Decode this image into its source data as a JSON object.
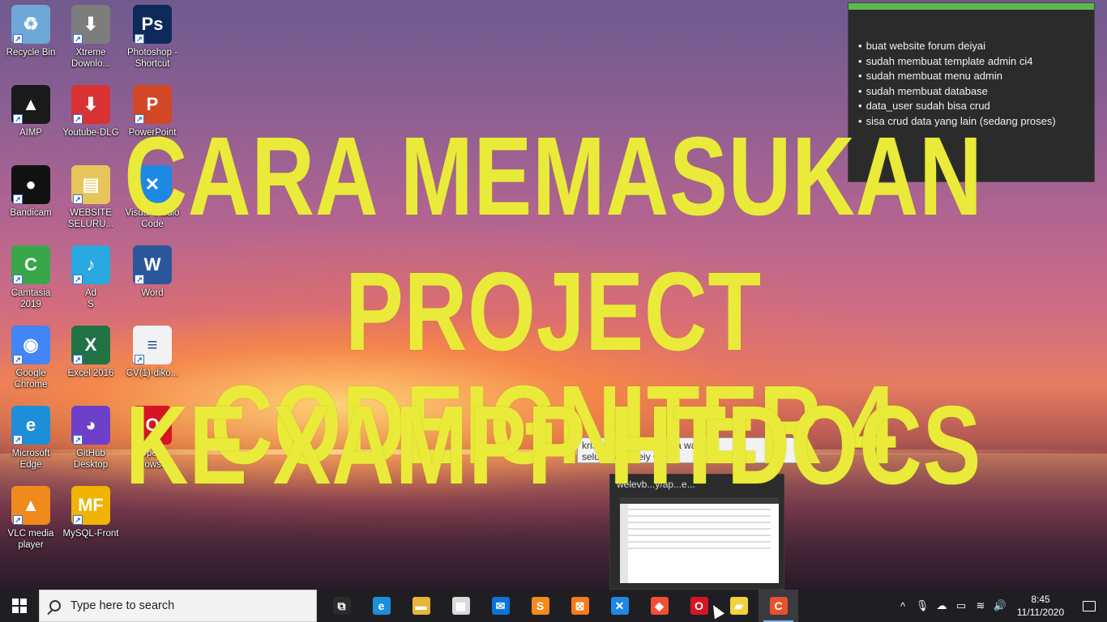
{
  "desktop_icons": [
    {
      "label": "Recycle Bin",
      "icon": "recycle-bin-icon",
      "color": "#6ea8d8",
      "glyph": "♻"
    },
    {
      "label": "Xtreme\nDownlo...",
      "icon": "download-icon",
      "color": "#7d7d7d",
      "glyph": "⬇"
    },
    {
      "label": "Photoshop -\nShortcut",
      "icon": "photoshop-icon",
      "color": "#0d2a5a",
      "glyph": "Ps"
    },
    {
      "label": "AIMP",
      "icon": "aimp-icon",
      "color": "#1a1a1a",
      "glyph": "▲"
    },
    {
      "label": "Youtube-DLG",
      "icon": "youtube-dlg-icon",
      "color": "#d83232",
      "glyph": "⬇"
    },
    {
      "label": "PowerPoint\n2016",
      "icon": "powerpoint-icon",
      "color": "#d24726",
      "glyph": "P"
    },
    {
      "label": "Bandicam",
      "icon": "bandicam-icon",
      "color": "#111111",
      "glyph": "●"
    },
    {
      "label": "WEBSITE\nSELURU...",
      "icon": "folder-icon",
      "color": "#e8c55a",
      "glyph": "▤"
    },
    {
      "label": "Visual Studio\nCode",
      "icon": "vscode-icon",
      "color": "#1e88e5",
      "glyph": "✕"
    },
    {
      "label": "Camtasia\n2019",
      "icon": "camtasia-icon",
      "color": "#3aa64a",
      "glyph": "C"
    },
    {
      "label": "Ad\nS",
      "icon": "music-app-icon",
      "color": "#2aa8e0",
      "glyph": "♪"
    },
    {
      "label": "Word",
      "icon": "word-icon",
      "color": "#2b579a",
      "glyph": "W"
    },
    {
      "label": "Google\nChrome",
      "icon": "chrome-icon",
      "color": "#4285f4",
      "glyph": "◉"
    },
    {
      "label": "Excel 2016",
      "icon": "excel-icon",
      "color": "#217346",
      "glyph": "X"
    },
    {
      "label": "CV(1)-diko...",
      "icon": "document-icon",
      "color": "#f2f2f2",
      "glyph": "≡"
    },
    {
      "label": "Microsoft\nEdge",
      "icon": "edge-icon",
      "color": "#1c8fd8",
      "glyph": "e"
    },
    {
      "label": "GitHub\nDesktop",
      "icon": "github-icon",
      "color": "#6e40c9",
      "glyph": "◕"
    },
    {
      "label": "Opera\nBrowser",
      "icon": "opera-icon",
      "color": "#d61424",
      "glyph": "O"
    },
    {
      "label": "VLC media\nplayer",
      "icon": "vlc-icon",
      "color": "#f08a1c",
      "glyph": "▲"
    },
    {
      "label": "MySQL-Front",
      "icon": "mysql-front-icon",
      "color": "#f0b400",
      "glyph": "MF"
    }
  ],
  "sticky_note": {
    "items": [
      "buat website forum deiyai",
      "sudah membuat template admin ci4",
      "sudah membuat menu admin",
      "sudah membuat database",
      "data_user sudah bisa crud",
      "sisa crud data yang lain (sedang proses)"
    ],
    "accent": "#5db851"
  },
  "headline": {
    "line1": "CARA MEMASUKAN",
    "line2": "PROJECT CODEIGNITER 4",
    "line3": "KE XAMPP HTDOCS",
    "color": "#eaea3a"
  },
  "tooltip": {
    "line1": "kristo  appst  web  ka  ma  wa",
    "line2": "seluru  ou  n deiy  Oper"
  },
  "preview": {
    "title": "welevb...y/ap...e..."
  },
  "taskbar": {
    "search_placeholder": "Type here to search",
    "apps": [
      {
        "name": "task-view",
        "icon": "task-view-icon",
        "glyph": "⧉",
        "color": "#2b2b2b"
      },
      {
        "name": "edge",
        "icon": "edge-icon",
        "glyph": "e",
        "color": "#1c8fd8"
      },
      {
        "name": "file-explorer",
        "icon": "folder-icon",
        "glyph": "▬",
        "color": "#e8b53a"
      },
      {
        "name": "store",
        "icon": "store-icon",
        "glyph": "▦",
        "color": "#d9d9d9"
      },
      {
        "name": "mail",
        "icon": "mail-icon",
        "glyph": "✉",
        "color": "#0a74da"
      },
      {
        "name": "sublime",
        "icon": "sublime-icon",
        "glyph": "S",
        "color": "#f48a1c"
      },
      {
        "name": "xampp",
        "icon": "xampp-icon",
        "glyph": "⊠",
        "color": "#f47b20"
      },
      {
        "name": "vscode",
        "icon": "vscode-icon",
        "glyph": "✕",
        "color": "#1e88e5"
      },
      {
        "name": "git",
        "icon": "git-icon",
        "glyph": "◆",
        "color": "#f14e32"
      },
      {
        "name": "opera",
        "icon": "opera-icon",
        "glyph": "O",
        "color": "#d61424"
      },
      {
        "name": "sticky-notes",
        "icon": "sticky-notes-icon",
        "glyph": "▰",
        "color": "#f3d23c"
      },
      {
        "name": "camtasia",
        "icon": "camtasia-icon",
        "glyph": "C",
        "color": "#e5532c"
      }
    ],
    "active_app": "camtasia",
    "clock_time": "8:45",
    "clock_date": "11/11/2020"
  }
}
